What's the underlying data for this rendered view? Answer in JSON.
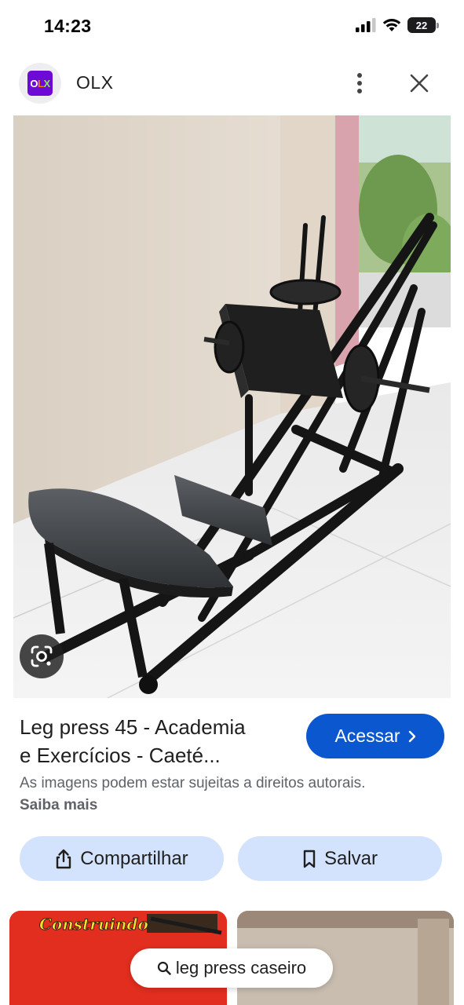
{
  "status_bar": {
    "time": "14:23",
    "battery_level": "22"
  },
  "header": {
    "site_name": "OLX",
    "logo_letters": [
      "O",
      "L",
      "X"
    ]
  },
  "image": {
    "subject": "leg press 45 machine",
    "lens_icon": "lens-icon"
  },
  "result": {
    "title_lines": [
      "Leg press 45 - Academia",
      "e Exercícios - Caeté..."
    ],
    "visit_label": "Acessar",
    "copyright_text": "As imagens podem estar sujeitas a direitos autorais.",
    "learn_more_label": "Saiba mais"
  },
  "actions": {
    "share_label": "Compartilhar",
    "save_label": "Salvar"
  },
  "related": {
    "thumb_1_caption": "Construindo"
  },
  "search_chip": {
    "query": "leg press caseiro"
  },
  "colors": {
    "accent": "#0b57d0",
    "chip_bg": "#d3e3fd",
    "brand": "#6e0ad6"
  }
}
